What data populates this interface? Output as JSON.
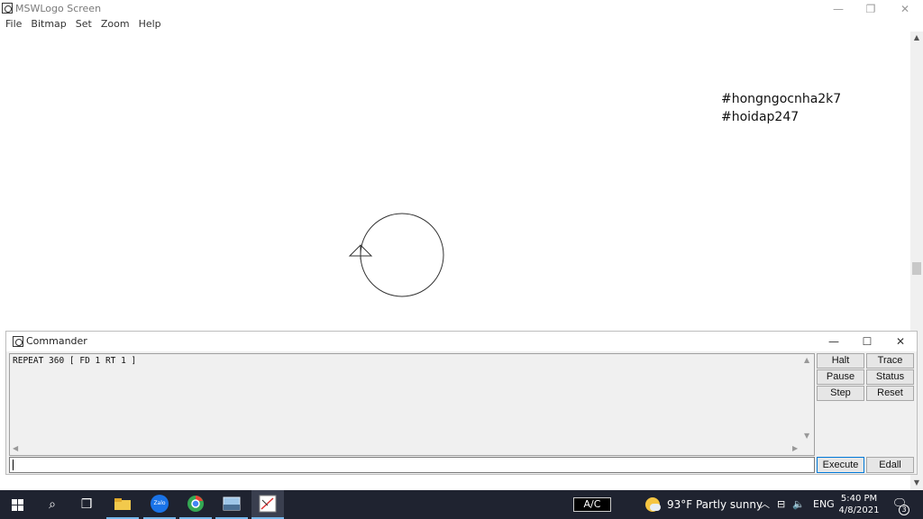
{
  "window": {
    "title": "MSWLogo Screen",
    "minimize": "—",
    "maximize": "❐",
    "close": "✕"
  },
  "menu": [
    "File",
    "Bitmap",
    "Set",
    "Zoom",
    "Help"
  ],
  "canvas": {
    "hashtags": [
      "#hongngocnha2k7",
      "#hoidap247"
    ]
  },
  "scrollbar": {
    "up": "▲",
    "down": "▼"
  },
  "commander": {
    "title": "Commander",
    "minimize": "—",
    "maximize": "☐",
    "close": "✕",
    "history": "REPEAT 360 [ FD 1 RT 1 ]",
    "input_value": "",
    "buttons": {
      "halt": "Halt",
      "trace": "Trace",
      "pause": "Pause",
      "status": "Status",
      "step": "Step",
      "reset": "Reset",
      "execute": "Execute",
      "edall": "Edall"
    },
    "arrows": {
      "up": "▲",
      "down": "▼",
      "left": "◀",
      "right": "▶"
    }
  },
  "taskbar": {
    "search_glyph": "⌕",
    "taskview_glyph": "❒",
    "zalo_label": "Zalo",
    "ac_label": "A/C",
    "weather": "93°F  Partly sunny",
    "tray_chevron": "︿",
    "tray_net": "⊟",
    "tray_volume": "🔈",
    "language": "ENG",
    "time": "5:40 PM",
    "date": "4/8/2021",
    "notif_glyph": "🗨",
    "notification_count": "3"
  }
}
